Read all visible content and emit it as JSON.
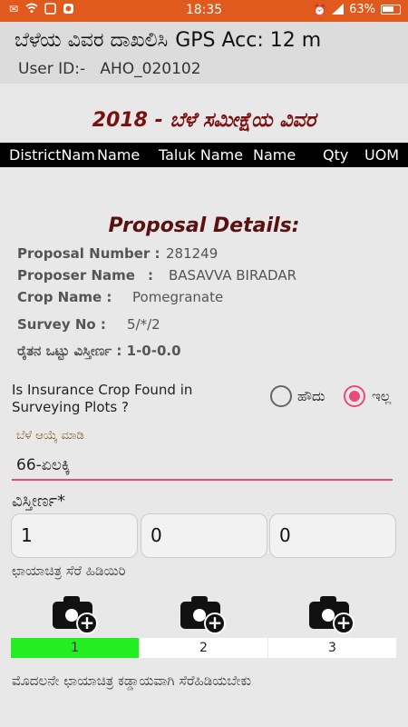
{
  "status_bar": {
    "time": "18:35",
    "battery": "63%",
    "left_icons": [
      "envelope-icon",
      "wifi-icon",
      "box-icon",
      "app-icon"
    ],
    "right_icons": [
      "alarm-icon",
      "signal-icon",
      "battery-icon"
    ]
  },
  "header": {
    "title": "ಬೆಳೆಯ ವಿವರ ದಾಖಲಿಸಿ",
    "gps": "GPS Acc: 12 m",
    "user_label": "User ID:-",
    "user_id": "AHO_020102"
  },
  "survey_title": "2018 - ಬೆಳೆ ಸಮೀಕ್ಷೆಯ ವಿವರ",
  "table_header": [
    "DistrictNam",
    "Name",
    "Taluk Name",
    "Name",
    "Qty",
    "UOM"
  ],
  "proposal": {
    "title": "Proposal Details:",
    "number_label": "Proposal Number :",
    "number_value": "281249",
    "proposer_label": "Proposer Name",
    "proposer_colon": ":",
    "proposer_value": "BASAVVA BIRADAR",
    "crop_label": "Crop Name :",
    "crop_value": "Pomegranate",
    "survey_label": "Survey No :",
    "survey_value": "5/*/2",
    "area_label": "ರೈತನ ಒಟ್ಟು ವಿಸ್ತೀರ್ಣ : 1-0-0.0"
  },
  "question": {
    "text": "Is Insurance Crop Found in Surveying Plots ?",
    "yes_label": "ಹೌದು",
    "no_label": "ಇಲ್ಲ",
    "selected": "no"
  },
  "crop_select": {
    "label": "ಬೆಳೆ ಆಯ್ಕೆ ಮಾಡಿ",
    "value": "66-ಏಲಕ್ಕಿ"
  },
  "area": {
    "label": "ವಿಸ್ತೀರ್ಣ*",
    "values": [
      "1",
      "0",
      "0"
    ]
  },
  "photo": {
    "label": "ಛಾಯಾಚಿತ್ರ ಸೆರೆ ಹಿಡಿಯಿರಿ",
    "steps": [
      "1",
      "2",
      "3"
    ],
    "completed": 1,
    "footer": "ಮೊದಲನೇ ಛಾಯಾಚಿತ್ರ ಕಡ್ಡಾಯವಾಗಿ ಸೆರೆಹಿಡಿಯಬೇಕು"
  },
  "colors": {
    "status_bar": "#e05a1e",
    "accent": "#e84a7a",
    "title": "#7a1010",
    "progress_done": "#22ee22"
  }
}
